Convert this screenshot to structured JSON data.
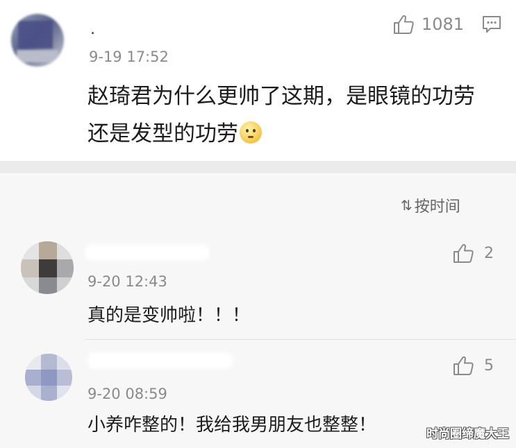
{
  "main_comment": {
    "username": ".",
    "timestamp": "9-19 17:52",
    "text": "赵琦君为什么更帅了这期，是眼镜的功劳还是发型的功劳",
    "emoji": "thinking-face-emoji",
    "like_count": "1081",
    "like_icon": "thumbs-up-icon",
    "reply_icon": "comment-icon"
  },
  "replies_section": {
    "sort_label": "按时间",
    "sort_icon": "sort-icon",
    "items": [
      {
        "timestamp": "9-20 12:43",
        "text": "真的是变帅啦！！！",
        "like_count": "2"
      },
      {
        "timestamp": "9-20 08:59",
        "text": "小养咋整的！我给我男朋友也整整！",
        "like_count": "5"
      }
    ]
  },
  "watermark": "时尚圈缔魔大王"
}
